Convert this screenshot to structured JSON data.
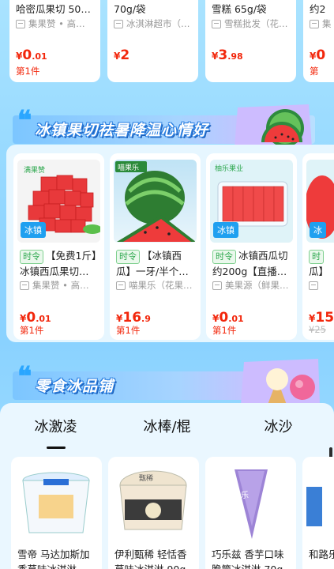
{
  "top_row": [
    {
      "title": "哈密瓜果切 500…",
      "store": "集果赞 • 高品…",
      "price_main": "0",
      "price_dec": ".01",
      "piece": "第1件"
    },
    {
      "title": "70g/袋",
      "store": "冰淇淋超市（…",
      "price_main": "2",
      "price_dec": "",
      "piece": ""
    },
    {
      "title": "雪糕 65g/袋",
      "store": "雪糕批发（花…",
      "price_main": "3",
      "price_dec": ".98",
      "piece": ""
    },
    {
      "title": "约2",
      "store": "集",
      "price_main": "0",
      "price_dec": "",
      "piece": "第"
    }
  ],
  "banner1": {
    "text": "冰镇果切祛暑降温心情好"
  },
  "fruit_row": [
    {
      "brand_tag": "满果赞",
      "ice_tag": "冰镇",
      "shiling": "时令",
      "title": "【免费1斤】冰镇西瓜果切…",
      "store": "集果赞 • 高品…",
      "price_main": "0",
      "price_dec": ".01",
      "piece": "第1件",
      "orig": ""
    },
    {
      "brand_tag": "喵果乐",
      "ice_tag": "",
      "shiling": "时令",
      "title": "【冰镇西瓜】一牙/半个…",
      "store": "喵果乐（花果…",
      "price_main": "16",
      "price_dec": ".9",
      "piece": "第1件",
      "orig": ""
    },
    {
      "brand_tag": "柚乐果业",
      "ice_tag": "冰镇",
      "shiling": "时令",
      "title": "冰镇西瓜切约200g【直播…",
      "store": "美果源（鲜果…",
      "price_main": "0",
      "price_dec": ".01",
      "piece": "第1件",
      "orig": ""
    },
    {
      "brand_tag": "",
      "ice_tag": "冰",
      "shiling": "时",
      "title": "瓜】",
      "store": "",
      "price_main": "15",
      "price_dec": "",
      "piece": "",
      "orig": "¥25"
    }
  ],
  "banner2": {
    "text": "零食冰品铺"
  },
  "tabs": [
    "冰激凌",
    "冰棒/棍",
    "冰沙"
  ],
  "ice_row": [
    {
      "title": "雪帝 马达加斯加香草味冰淇淋…"
    },
    {
      "title": "伊利甄稀 轻恬香草味冰淇淋 90g"
    },
    {
      "title": "巧乐兹 香芋口味脆筒冰淇淋 70g"
    },
    {
      "title": "和路乐天"
    }
  ],
  "currency": "¥"
}
